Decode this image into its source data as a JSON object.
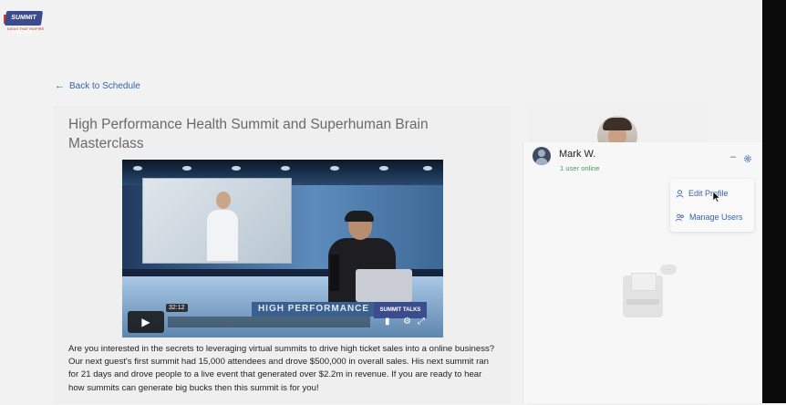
{
  "brand": {
    "logo_text": "SUMMIT TALKS",
    "logo_subtext": "IDEAS THAT INSPIRE",
    "colors": {
      "logo_blue": "#3b4c8c",
      "logo_red": "#d43c2c"
    }
  },
  "nav": {
    "back_label": "Back to Schedule",
    "back_icon": "arrow-left-icon"
  },
  "event": {
    "title": "High Performance Health Summit and Superhuman Brain Masterclass",
    "video": {
      "duration": "32:12",
      "banner_text": "HIGH PERFORMANCE",
      "overlay_logo": "SUMMIT TALKS",
      "controls": [
        "play-icon",
        "volume-icon",
        "settings-icon",
        "fullscreen-icon"
      ]
    },
    "description": "Are you interested in the secrets to leveraging virtual summits to drive high ticket sales into a online business? Our next guest's first summit had 15,000 attendees and drove $500,000 in overall sales. His next summit ran for 21 days and drove people to a live event that generated over $2.2m in revenue. If you are ready to hear how summits can generate big bucks then this summit is for you!"
  },
  "chat": {
    "user_name": "Mark W.",
    "status": "1 user online",
    "status_color": "#4c9a5d",
    "accent_color": "#3b63a8",
    "menu": [
      {
        "label": "Edit Profile",
        "icon": "user-icon"
      },
      {
        "label": "Manage Users",
        "icon": "users-icon"
      }
    ]
  }
}
